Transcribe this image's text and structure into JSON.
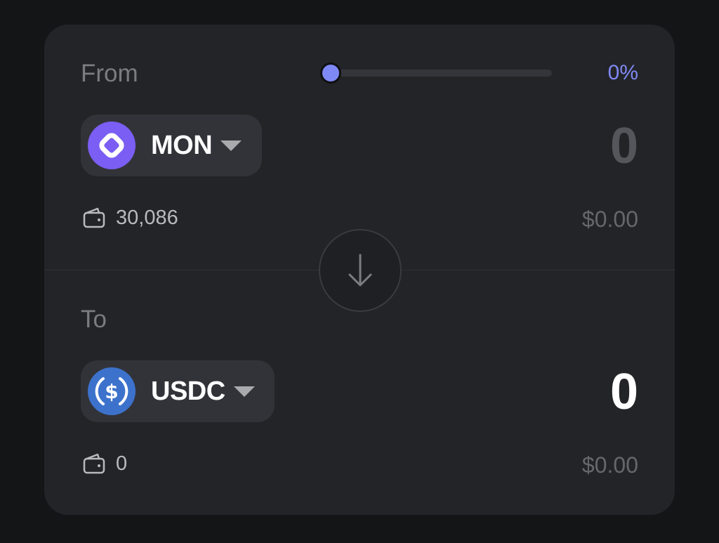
{
  "from": {
    "label": "From",
    "percent": "0%",
    "slider_fraction": 0,
    "token": {
      "symbol": "MON",
      "icon": "monad-icon",
      "color": "#7b5ef3"
    },
    "amount": "0",
    "balance": "30,086",
    "usd_value": "$0.00"
  },
  "swap": {
    "icon": "arrow-down-icon"
  },
  "to": {
    "label": "To",
    "token": {
      "symbol": "USDC",
      "icon": "usdc-icon",
      "color": "#3d72cc"
    },
    "amount": "0",
    "balance": "0",
    "usd_value": "$0.00"
  },
  "colors": {
    "accent": "#7f89f5",
    "card": "#232427",
    "background": "#131516"
  }
}
